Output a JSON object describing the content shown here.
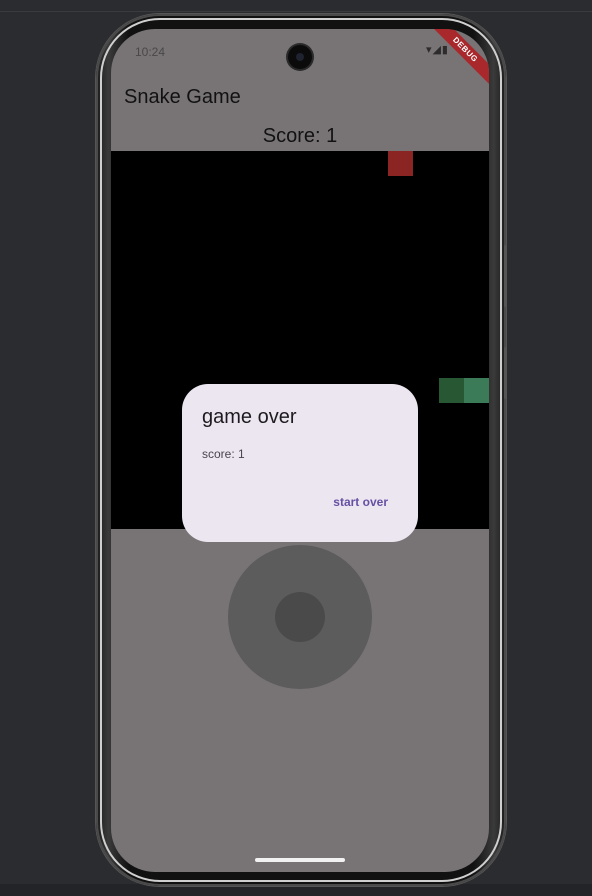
{
  "status_bar": {
    "time": "10:24",
    "icons": "▾◢▮"
  },
  "debug_banner": "DEBUG",
  "app_bar": {
    "title": "Snake Game"
  },
  "score_label": "Score: 1",
  "dialog": {
    "title": "game over",
    "content": "score: 1",
    "action": "start over"
  },
  "colors": {
    "board": "#000000",
    "food": "#8b2523",
    "snake_body": "#275733",
    "snake_head": "#3b7b58",
    "dialog_bg": "#ece6f0",
    "accent": "#6750a4"
  }
}
